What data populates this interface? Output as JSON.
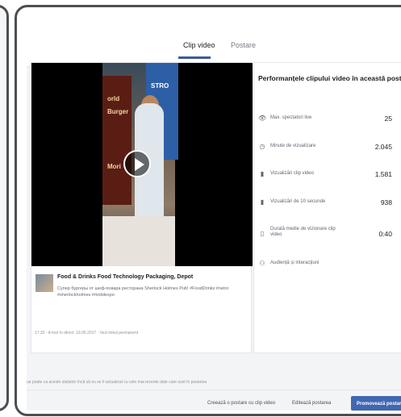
{
  "tabs": [
    {
      "label": "Clip video"
    },
    {
      "label": "Postare"
    }
  ],
  "video": {
    "scene_text_1": "orld",
    "scene_text_2": "Burger",
    "scene_text_3": "Mori",
    "scene_text_4": "STRO",
    "title": "Food & Drinks Food Technology Packaging, Depot",
    "description": "Супер бургеры от шеф-повара ресторана Sherlock Holmes Pub! #FoodDrinks #netro #sherlockholmes #mobilexpo",
    "meta": "17:32 · A fost în direct: 19.05.2017 · Vezi linkul permanent"
  },
  "performance": {
    "title": "Performanțele clipului video în această postare",
    "rows": [
      {
        "icon": "eye-icon",
        "glyph": "👁",
        "label": "Max. spectatori live",
        "value": "25"
      },
      {
        "icon": "clock-icon",
        "glyph": "◷",
        "label": "Minute de vizualizare",
        "value": "2.045"
      },
      {
        "icon": "bar-chart-icon",
        "glyph": "▮",
        "label": "Vizualizări clip video",
        "value": "1.581"
      },
      {
        "icon": "bar-chart-icon",
        "glyph": "▮",
        "label": "Vizualizări de 10 secunde",
        "value": "938"
      },
      {
        "icon": "duration-icon",
        "glyph": "▯",
        "label": "Durată medie de vizionare clip video",
        "value": "0:40"
      },
      {
        "icon": "audience-icon",
        "glyph": "⚇",
        "label": "Audiență și interacțiuni",
        "value": ""
      }
    ]
  },
  "footer": {
    "note": "ue poate ca aceste statistici încă să nu se fi actualizat cu cele mai recente date care sunt în postarea",
    "buttons": [
      {
        "label": "Creează o postare cu clip video"
      },
      {
        "label": "Editează postarea"
      },
      {
        "label": "Promovează postarea"
      }
    ]
  },
  "colors": {
    "accent": "#4267b2",
    "frame": "#4b4e53"
  }
}
